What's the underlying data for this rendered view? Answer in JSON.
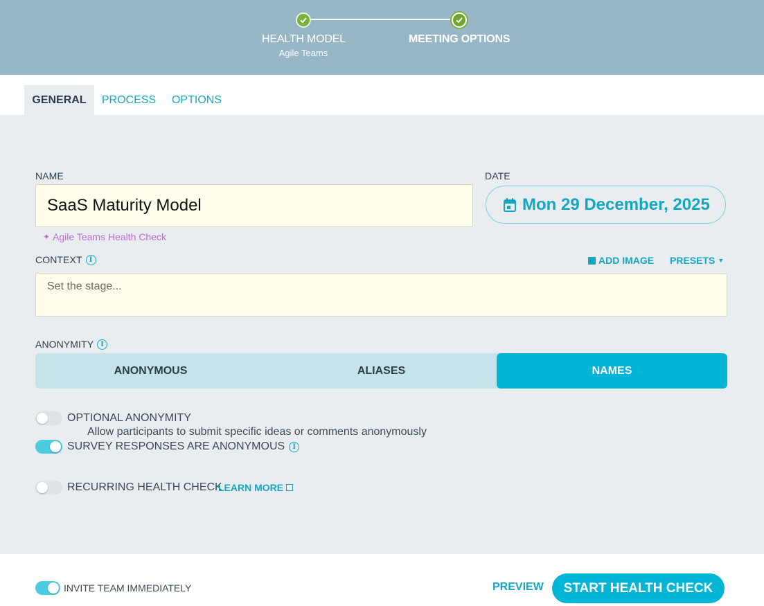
{
  "stepper": {
    "steps": [
      {
        "label": "HEALTH MODEL",
        "sub": "Agile Teams"
      },
      {
        "label": "MEETING OPTIONS"
      }
    ]
  },
  "tabs": [
    "GENERAL",
    "PROCESS",
    "OPTIONS"
  ],
  "name": {
    "label": "NAME",
    "value": "SaaS Maturity Model",
    "hint": "Agile Teams Health Check"
  },
  "date": {
    "label": "DATE",
    "value": "Mon 29 December, 2025"
  },
  "context": {
    "label": "CONTEXT",
    "placeholder": "Set the stage...",
    "add_image": "ADD IMAGE",
    "presets": "PRESETS"
  },
  "anonymity": {
    "label": "ANONYMITY",
    "options": [
      "ANONYMOUS",
      "ALIASES",
      "NAMES"
    ],
    "selected": "NAMES"
  },
  "toggles": {
    "optional_anonymity": {
      "label": "OPTIONAL ANONYMITY",
      "desc": "Allow participants to submit specific ideas or comments anonymously",
      "on": false
    },
    "survey_anonymous": {
      "label": "SURVEY RESPONSES ARE ANONYMOUS",
      "on": true
    },
    "recurring": {
      "label": "RECURRING HEALTH CHECK",
      "learn_more": "LEARN MORE",
      "on": false
    }
  },
  "footer": {
    "invite": {
      "label": "INVITE TEAM IMMEDIATELY",
      "on": true
    },
    "preview": "PREVIEW",
    "start": "START HEALTH CHECK"
  },
  "colors": {
    "accent": "#00b5d5",
    "header": "#97b6c6",
    "panel": "#e9edf0",
    "success": "#7bb13d",
    "hint": "#b66ccf"
  }
}
